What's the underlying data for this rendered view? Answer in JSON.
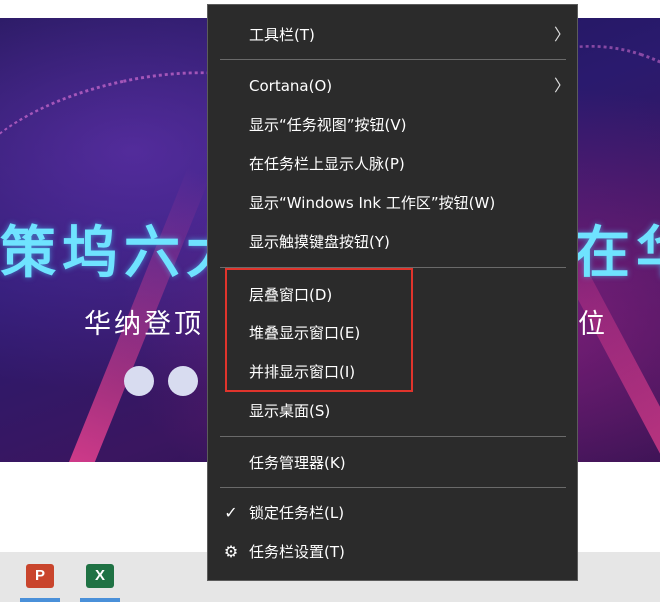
{
  "background": {
    "headline_left": "策坞六大",
    "headline_right": "在华",
    "subline_left": "华纳登顶",
    "subline_right": "位"
  },
  "menu": {
    "items": [
      {
        "label": "工具栏(T)",
        "submenu_icon": "chevron-right-icon"
      },
      {
        "label": "Cortana(O)",
        "submenu_icon": "chevron-right-icon"
      },
      {
        "label": "显示“任务视图”按钮(V)"
      },
      {
        "label": "在任务栏上显示人脉(P)"
      },
      {
        "label": "显示“Windows Ink 工作区”按钮(W)"
      },
      {
        "label": "显示触摸键盘按钮(Y)"
      },
      {
        "label": "层叠窗口(D)"
      },
      {
        "label": "堆叠显示窗口(E)"
      },
      {
        "label": "并排显示窗口(I)"
      },
      {
        "label": "显示桌面(S)"
      },
      {
        "label": "任务管理器(K)"
      },
      {
        "label": "锁定任务栏(L)",
        "checked": true,
        "lead_icon": "checkmark-icon"
      },
      {
        "label": "任务栏设置(T)",
        "lead_icon": "gear-icon"
      }
    ],
    "highlight_color": "#e0342c"
  },
  "taskbar": {
    "apps": [
      {
        "name": "PowerPoint",
        "glyph": "P",
        "color": "#c9452d"
      },
      {
        "name": "Excel",
        "glyph": "X",
        "color": "#1f7244"
      }
    ]
  },
  "glyphs": {
    "chevron": "〉",
    "check": "✓",
    "gear": "⚙"
  }
}
